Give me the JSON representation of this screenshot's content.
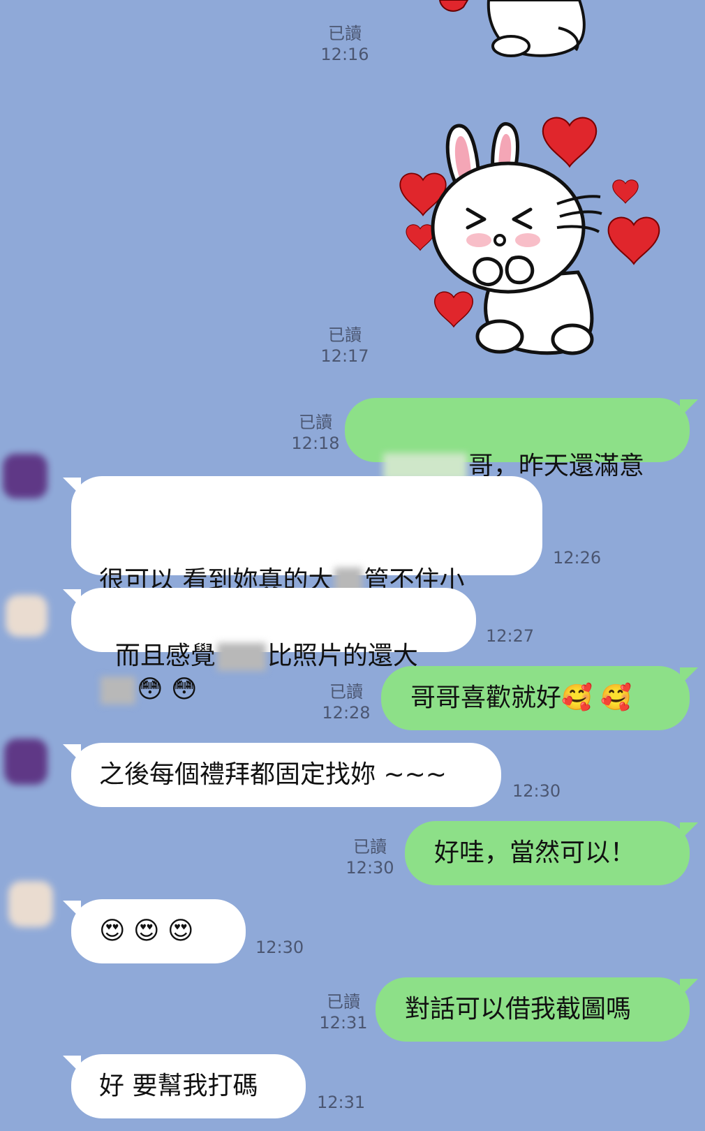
{
  "read_label": "已讀",
  "messages": [
    {
      "id": "s1",
      "read": "已讀",
      "time": "12:16"
    },
    {
      "id": "s2",
      "read": "已讀",
      "time": "12:17"
    },
    {
      "id": "m1",
      "direction": "out",
      "read": "已讀",
      "time": "12:18",
      "text_after": "哥，昨天還滿意吧"
    },
    {
      "id": "m2",
      "direction": "in",
      "time": "12:26",
      "line1_a": "很可以 看到妳真的大",
      "line1_b": "管不住小",
      "line2_emoji": "😳 😳"
    },
    {
      "id": "m3",
      "direction": "in",
      "time": "12:27",
      "text_a": "而且感覺",
      "text_b": "比照片的還大"
    },
    {
      "id": "m4",
      "direction": "out",
      "read": "已讀",
      "time": "12:28",
      "text": "哥哥喜歡就好",
      "emoji": "🥰 🥰"
    },
    {
      "id": "m5",
      "direction": "in",
      "time": "12:30",
      "text": "之後每個禮拜都固定找妳 ~~~"
    },
    {
      "id": "m6",
      "direction": "out",
      "read": "已讀",
      "time": "12:30",
      "text": "好哇，當然可以！"
    },
    {
      "id": "m7",
      "direction": "in",
      "time": "12:30",
      "emoji": "😍 😍 😍"
    },
    {
      "id": "m8",
      "direction": "out",
      "read": "已讀",
      "time": "12:31",
      "text": "對話可以借我截圖嗎"
    },
    {
      "id": "m9",
      "direction": "in",
      "time": "12:31",
      "text": "好 要幫我打碼"
    }
  ],
  "colors": {
    "background": "#8fa9d8",
    "outgoing_bubble": "#8de088",
    "incoming_bubble": "#ffffff",
    "meta_text": "#4b5671",
    "heart": "#e0262c"
  },
  "stickers": [
    {
      "name": "bunny-sticker-top",
      "icon": "cony-rabbit-hearts"
    },
    {
      "name": "bunny-sticker-main",
      "icon": "cony-rabbit-hearts"
    }
  ]
}
